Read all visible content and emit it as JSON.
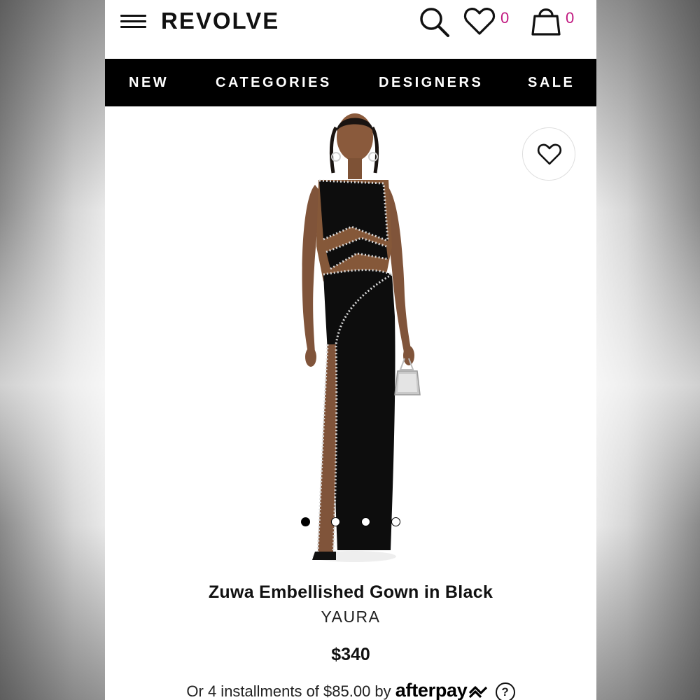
{
  "header": {
    "logo": "REVOLVE",
    "wishlist_count": "0",
    "bag_count": "0"
  },
  "nav": {
    "items": [
      "NEW",
      "CATEGORIES",
      "DESIGNERS",
      "SALE"
    ]
  },
  "gallery": {
    "image_count": 4,
    "active_index": 0
  },
  "product": {
    "name": "Zuwa Embellished Gown in Black",
    "brand": "YAURA",
    "price": "$340",
    "installments_prefix": "Or 4 installments of $85.00 by",
    "installments_provider": "afterpay",
    "help_symbol": "?"
  },
  "colors": {
    "accent": "#c0177f",
    "nav_bg": "#000000",
    "gown": "#0d0d0d",
    "trim": "#d8d8d8"
  },
  "icons": {
    "menu": "hamburger-icon",
    "search": "search-icon",
    "wishlist": "heart-icon",
    "bag": "bag-icon",
    "afterpay_logo": "afterpay-arrows-icon"
  }
}
